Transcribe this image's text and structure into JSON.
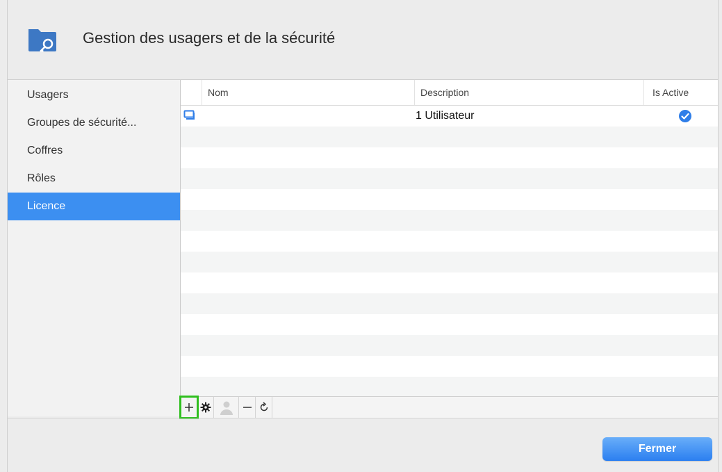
{
  "window": {
    "title": "Gestion des usagers et de la sécurité",
    "app_icon": "folder-key-icon"
  },
  "sidebar": {
    "items": [
      {
        "label": "Usagers",
        "selected": false
      },
      {
        "label": "Groupes de sécurité...",
        "selected": false
      },
      {
        "label": "Coffres",
        "selected": false
      },
      {
        "label": "Rôles",
        "selected": false
      },
      {
        "label": "Licence",
        "selected": true
      }
    ]
  },
  "table": {
    "columns": [
      "Nom",
      "Description",
      "Is Active"
    ],
    "rows": [
      {
        "icon": "license-icon",
        "nom": "",
        "description": "1 Utilisateur",
        "is_active": true
      }
    ]
  },
  "toolbar": {
    "buttons": [
      {
        "icon": "plus-icon",
        "highlighted": true,
        "enabled": true
      },
      {
        "icon": "gear-icon",
        "highlighted": false,
        "enabled": true
      },
      {
        "icon": "user-icon",
        "highlighted": false,
        "enabled": false
      },
      {
        "icon": "minus-icon",
        "highlighted": false,
        "enabled": true
      },
      {
        "icon": "refresh-icon",
        "highlighted": false,
        "enabled": true
      }
    ]
  },
  "footer": {
    "close_label": "Fermer"
  },
  "colors": {
    "accent": "#3c8ff1",
    "highlight": "#2fbf1e",
    "check": "#2f7ee8"
  }
}
